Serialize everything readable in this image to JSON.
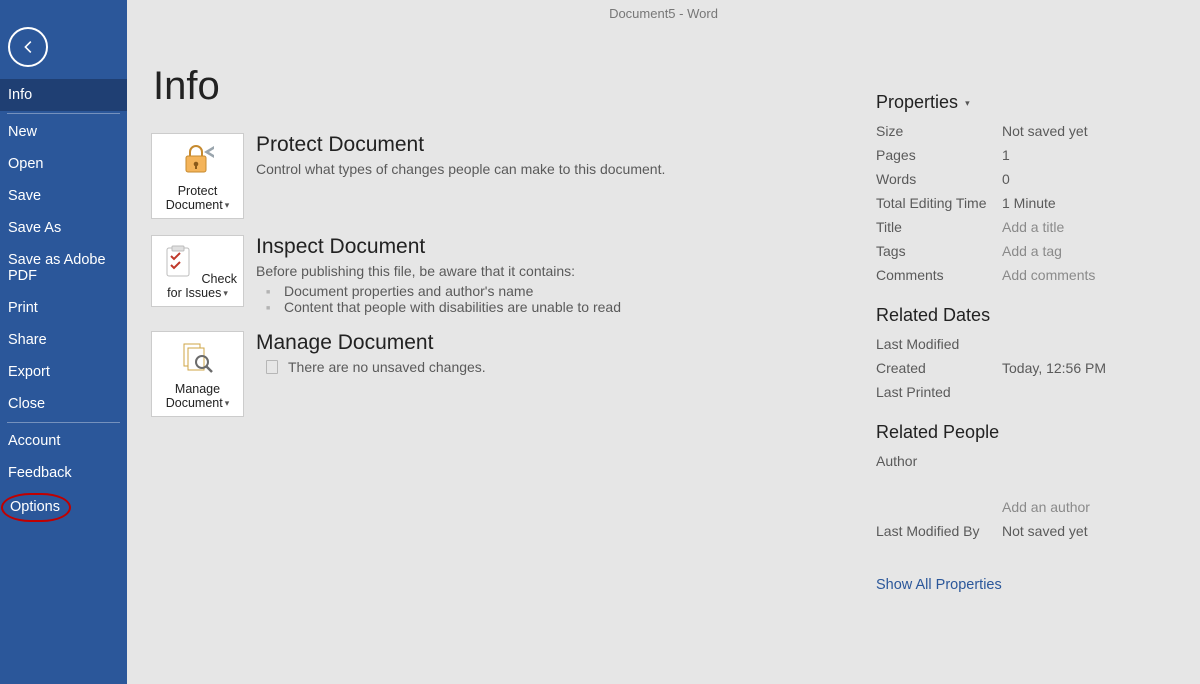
{
  "titlebar": "Document5  -  Word",
  "sidebar": {
    "items": [
      {
        "label": "Info",
        "selected": true
      },
      {
        "label": "New"
      },
      {
        "label": "Open"
      },
      {
        "label": "Save"
      },
      {
        "label": "Save As"
      },
      {
        "label": "Save as Adobe PDF"
      },
      {
        "label": "Print"
      },
      {
        "label": "Share"
      },
      {
        "label": "Export"
      },
      {
        "label": "Close"
      }
    ],
    "footer": [
      {
        "label": "Account"
      },
      {
        "label": "Feedback"
      },
      {
        "label": "Options",
        "highlighted": true
      }
    ]
  },
  "page_title": "Info",
  "sections": {
    "protect": {
      "button": "Protect Document",
      "title": "Protect Document",
      "desc": "Control what types of changes people can make to this document."
    },
    "inspect": {
      "button": "Check for Issues",
      "title": "Inspect Document",
      "desc": "Before publishing this file, be aware that it contains:",
      "items": [
        "Document properties and author's name",
        "Content that people with disabilities are unable to read"
      ]
    },
    "manage": {
      "button": "Manage Document",
      "title": "Manage Document",
      "desc": "There are no unsaved changes."
    }
  },
  "properties": {
    "heading": "Properties",
    "rows": {
      "size": {
        "label": "Size",
        "value": "Not saved yet"
      },
      "pages": {
        "label": "Pages",
        "value": "1"
      },
      "words": {
        "label": "Words",
        "value": "0"
      },
      "edit_time": {
        "label": "Total Editing Time",
        "value": "1 Minute"
      },
      "title": {
        "label": "Title",
        "value": "Add a title",
        "placeholder": true
      },
      "tags": {
        "label": "Tags",
        "value": "Add a tag",
        "placeholder": true
      },
      "comments": {
        "label": "Comments",
        "value": "Add comments",
        "placeholder": true
      }
    }
  },
  "related_dates": {
    "heading": "Related Dates",
    "rows": {
      "last_modified": {
        "label": "Last Modified",
        "value": ""
      },
      "created": {
        "label": "Created",
        "value": "Today, 12:56 PM"
      },
      "last_printed": {
        "label": "Last Printed",
        "value": ""
      }
    }
  },
  "related_people": {
    "heading": "Related People",
    "rows": {
      "author": {
        "label": "Author",
        "value": ""
      },
      "add_author": {
        "label": "",
        "value": "Add an author",
        "placeholder": true
      },
      "last_modified_by": {
        "label": "Last Modified By",
        "value": "Not saved yet"
      }
    }
  },
  "show_all": "Show All Properties"
}
